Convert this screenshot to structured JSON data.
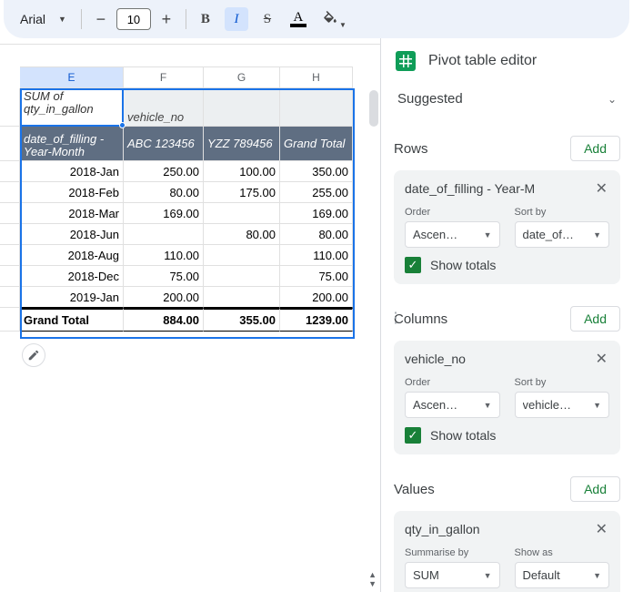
{
  "toolbar": {
    "font": "Arial",
    "font_size": "10",
    "bold_label": "B",
    "italic_label": "I",
    "strike_label": "S",
    "textcolor_label": "A"
  },
  "sheet": {
    "columns": [
      "E",
      "F",
      "G",
      "H"
    ],
    "corner_label": "SUM of qty_in_gallon",
    "col_group_label": "vehicle_no",
    "row_group_label": "date_of_filling - Year-Month",
    "col_headers": [
      "ABC 123456",
      "YZZ 789456",
      "Grand Total"
    ],
    "rows": [
      {
        "label": "2018-Jan",
        "v": [
          "250.00",
          "100.00",
          "350.00"
        ]
      },
      {
        "label": "2018-Feb",
        "v": [
          "80.00",
          "175.00",
          "255.00"
        ]
      },
      {
        "label": "2018-Mar",
        "v": [
          "169.00",
          "",
          "169.00"
        ]
      },
      {
        "label": "2018-Jun",
        "v": [
          "",
          "80.00",
          "80.00"
        ]
      },
      {
        "label": "2018-Aug",
        "v": [
          "110.00",
          "",
          "110.00"
        ]
      },
      {
        "label": "2018-Dec",
        "v": [
          "75.00",
          "",
          "75.00"
        ]
      },
      {
        "label": "2019-Jan",
        "v": [
          "200.00",
          "",
          "200.00"
        ]
      }
    ],
    "grand_total_label": "Grand Total",
    "grand_totals": [
      "884.00",
      "355.00",
      "1239.00"
    ]
  },
  "panel": {
    "title": "Pivot table editor",
    "suggested": "Suggested",
    "rows_title": "Rows",
    "columns_title": "Columns",
    "values_title": "Values",
    "add_label": "Add",
    "order_label": "Order",
    "sortby_label": "Sort by",
    "show_totals_label": "Show totals",
    "summarise_label": "Summarise by",
    "showas_label": "Show as",
    "row_chip": {
      "name": "date_of_filling - Year-M",
      "order": "Ascen…",
      "sort": "date_of…"
    },
    "col_chip": {
      "name": "vehicle_no",
      "order": "Ascen…",
      "sort": "vehicle…"
    },
    "val_chip": {
      "name": "qty_in_gallon",
      "summarise": "SUM",
      "showas": "Default"
    }
  }
}
